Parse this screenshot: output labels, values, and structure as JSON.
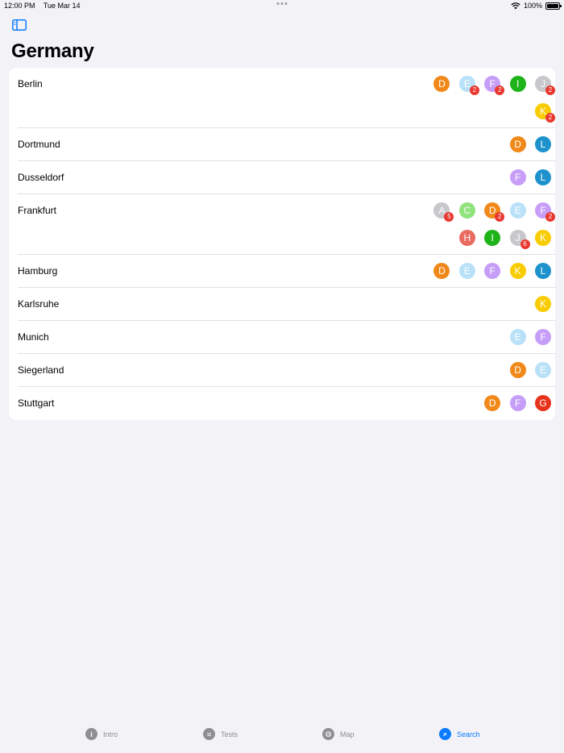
{
  "status": {
    "time": "12:00 PM",
    "date": "Tue Mar 14",
    "battery": "100%"
  },
  "header": {
    "title": "Germany"
  },
  "colors": {
    "A": "#c7c7cc",
    "C": "#8fe27c",
    "D": "#f0891a",
    "E": "#b9e1f8",
    "F": "#c69df7",
    "G": "#e8331c",
    "H": "#ea6b60",
    "I": "#1eb318",
    "J": "#c7c7cc",
    "K": "#f8cc00",
    "L": "#1d92cc",
    "count_badge": "#e8382f",
    "accent": "#0a7aff"
  },
  "cities": [
    {
      "name": "Berlin",
      "badges": [
        {
          "letter": "D"
        },
        {
          "letter": "E",
          "count": "2"
        },
        {
          "letter": "F",
          "count": "2"
        },
        {
          "letter": "I"
        },
        {
          "letter": "J",
          "count": "2"
        },
        {
          "letter": "K",
          "count": "2"
        }
      ]
    },
    {
      "name": "Dortmund",
      "badges": [
        {
          "letter": "D"
        },
        {
          "letter": "L"
        }
      ]
    },
    {
      "name": "Dusseldorf",
      "badges": [
        {
          "letter": "F"
        },
        {
          "letter": "L"
        }
      ]
    },
    {
      "name": "Frankfurt",
      "badges": [
        {
          "letter": "A",
          "count": "5"
        },
        {
          "letter": "C"
        },
        {
          "letter": "D",
          "count": "2"
        },
        {
          "letter": "E"
        },
        {
          "letter": "F",
          "count": "2"
        },
        {
          "letter": "H"
        },
        {
          "letter": "I"
        },
        {
          "letter": "J",
          "count": "6"
        },
        {
          "letter": "K"
        }
      ]
    },
    {
      "name": "Hamburg",
      "badges": [
        {
          "letter": "D"
        },
        {
          "letter": "E"
        },
        {
          "letter": "F"
        },
        {
          "letter": "K"
        },
        {
          "letter": "L"
        }
      ]
    },
    {
      "name": "Karlsruhe",
      "badges": [
        {
          "letter": "K"
        }
      ]
    },
    {
      "name": "Munich",
      "badges": [
        {
          "letter": "E"
        },
        {
          "letter": "F"
        }
      ]
    },
    {
      "name": "Siegerland",
      "badges": [
        {
          "letter": "D"
        },
        {
          "letter": "E"
        }
      ]
    },
    {
      "name": "Stuttgart",
      "badges": [
        {
          "letter": "D"
        },
        {
          "letter": "F"
        },
        {
          "letter": "G"
        }
      ]
    }
  ],
  "tabs": [
    {
      "label": "Intro",
      "icon": "info-icon",
      "glyph": "i"
    },
    {
      "label": "Tests",
      "icon": "list-icon",
      "glyph": "≡"
    },
    {
      "label": "Map",
      "icon": "globe-icon",
      "glyph": "◍"
    },
    {
      "label": "Search",
      "icon": "search-icon",
      "glyph": "⌕",
      "active": true
    }
  ]
}
